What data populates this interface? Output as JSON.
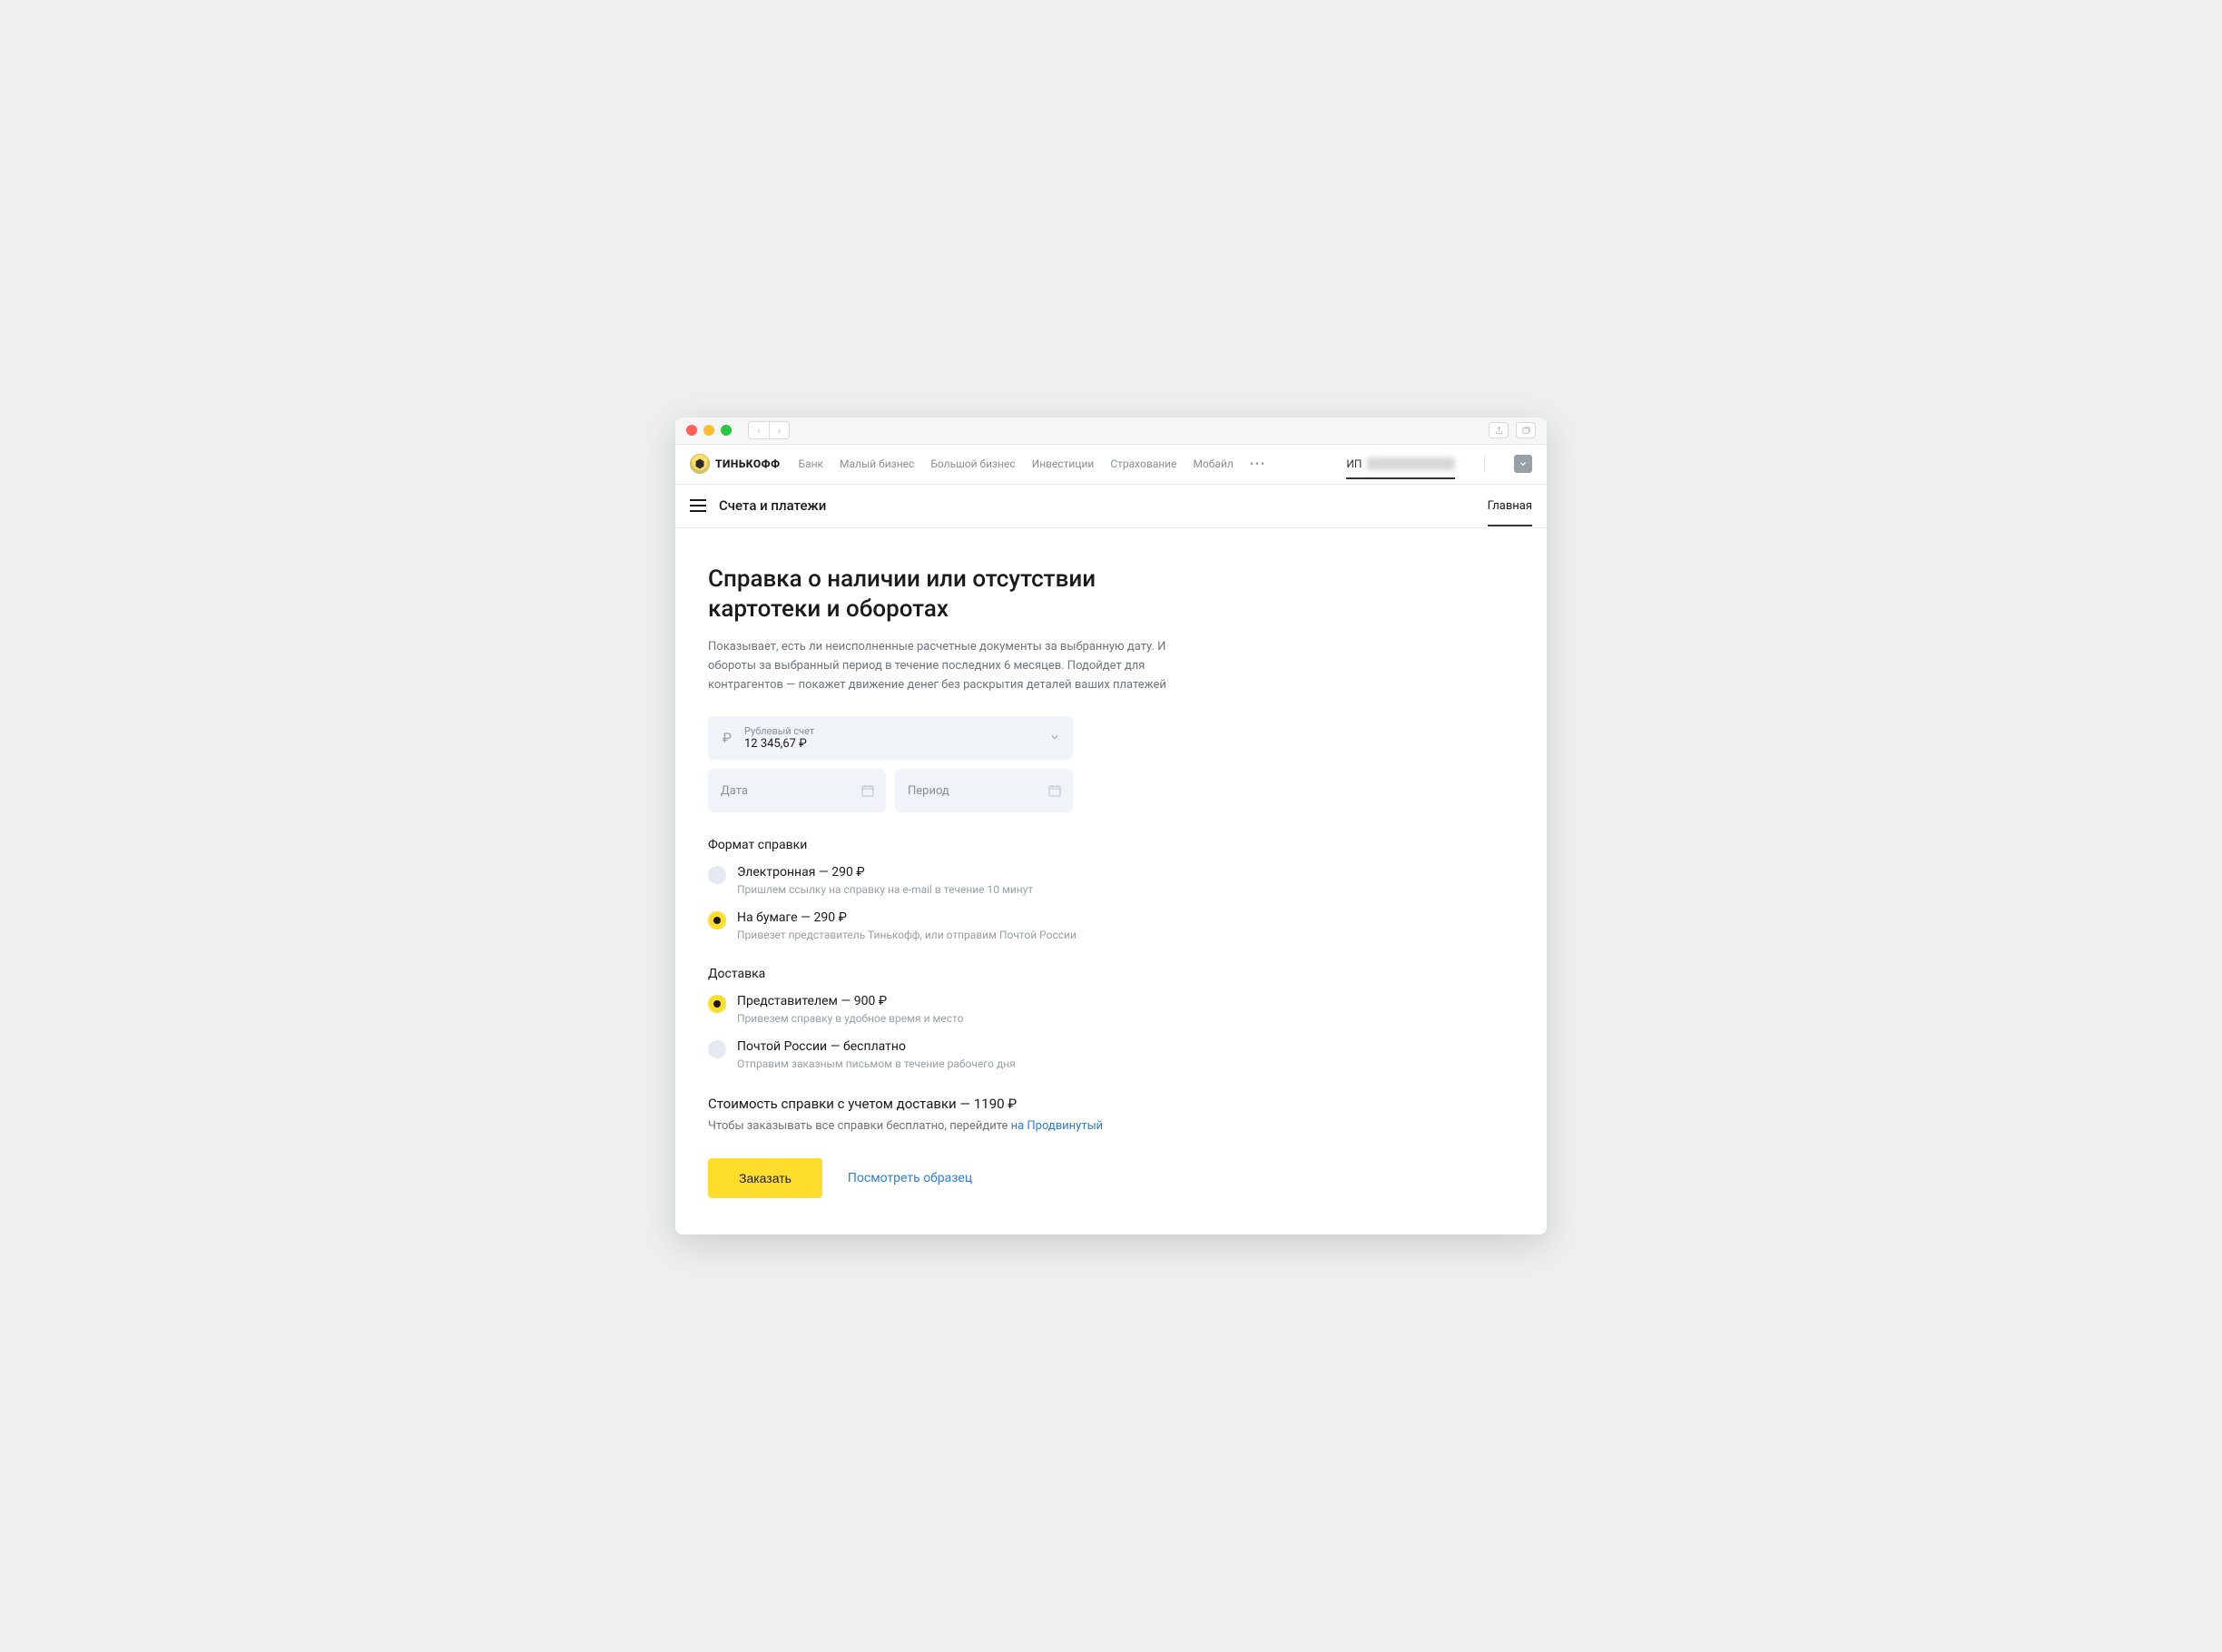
{
  "logo_text": "ТИНЬКОФФ",
  "global_nav": {
    "links": [
      "Банк",
      "Малый бизнес",
      "Большой бизнес",
      "Инвестиции",
      "Страхование",
      "Мобайл"
    ],
    "account_prefix": "ИП"
  },
  "subheader": {
    "title": "Счета и платежи",
    "tab": "Главная"
  },
  "page": {
    "title": "Справка о наличии или отсутствии картотеки и оборотах",
    "description": "Показывает, есть ли неисполненные расчетные документы за выбранную дату. И обороты за выбранный период в течение последних 6 месяцев. Подойдет для контрагентов — покажет движение денег без раскрытия деталей ваших платежей"
  },
  "account_field": {
    "label": "Рублевый счет",
    "value": "12 345,67 ₽"
  },
  "date_field": {
    "placeholder": "Дата"
  },
  "period_field": {
    "placeholder": "Период"
  },
  "format_section": {
    "title": "Формат справки",
    "options": [
      {
        "label": "Электронная — 290 ₽",
        "sub": "Пришлем ссылку на справку на e-mail в течение 10 минут",
        "selected": false
      },
      {
        "label": "На бумаге — 290 ₽",
        "sub": "Привезет представитель Тинькофф, или отправим Почтой России",
        "selected": true
      }
    ]
  },
  "delivery_section": {
    "title": "Доставка",
    "options": [
      {
        "label": "Представителем — 900 ₽",
        "sub": "Привезем справку в удобное время и место",
        "selected": true
      },
      {
        "label": "Почтой России — бесплатно",
        "sub": "Отправим заказным письмом в течение рабочего дня",
        "selected": false
      }
    ]
  },
  "total": {
    "line": "Стоимость справки с учетом доставки — 1190 ₽",
    "sub_prefix": "Чтобы заказывать все справки бесплатно, перейдите ",
    "sub_link": "на Продвинутый"
  },
  "actions": {
    "primary": "Заказать",
    "secondary": "Посмотреть образец"
  }
}
